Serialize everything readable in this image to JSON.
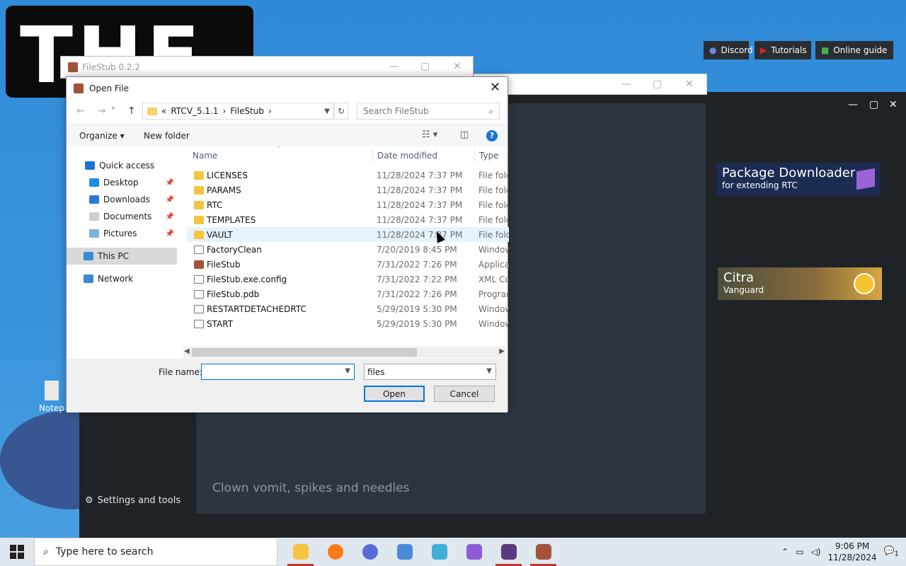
{
  "wallpaper": {
    "logo_text": "THE"
  },
  "background_window": {
    "title": "FileStub 0.2.2"
  },
  "rtc": {
    "buttons": [
      {
        "label": "Discord"
      },
      {
        "label": "Tutorials"
      },
      {
        "label": "Online guide"
      }
    ],
    "cards": [
      {
        "title": "Package Downloader",
        "subtitle": "for extending RTC"
      },
      {
        "title": "Citra",
        "subtitle": "Vanguard"
      }
    ],
    "quote": "Clown vomit, spikes and needles",
    "settings": "Settings and tools"
  },
  "dialog": {
    "title": "Open File",
    "breadcrumb": {
      "prefix": "«",
      "parts": [
        "RTCV_5.1.1",
        "FileStub"
      ]
    },
    "search_placeholder": "Search FileStub",
    "toolbar": {
      "organize": "Organize ▾",
      "new_folder": "New folder"
    },
    "nav": [
      {
        "label": "Quick access",
        "icon": "star-icon",
        "color": "#1b73d3"
      },
      {
        "label": "Desktop",
        "icon": "desktop-icon",
        "color": "#1b8fe0",
        "pinned": true
      },
      {
        "label": "Downloads",
        "icon": "download-icon",
        "color": "#2a7bd6",
        "pinned": true
      },
      {
        "label": "Documents",
        "icon": "documents-icon",
        "color": "#cfcfcf",
        "pinned": true
      },
      {
        "label": "Pictures",
        "icon": "pictures-icon",
        "color": "#7bb3e0",
        "pinned": true
      },
      {
        "label": "This PC",
        "icon": "computer-icon",
        "color": "#3a8ad6",
        "selected": true
      },
      {
        "label": "Network",
        "icon": "network-icon",
        "color": "#3a8ad6"
      }
    ],
    "columns": {
      "name": "Name",
      "date": "Date modified",
      "type": "Type"
    },
    "files": [
      {
        "name": "LICENSES",
        "date": "11/28/2024 7:37 PM",
        "type": "File folder",
        "kind": "folder"
      },
      {
        "name": "PARAMS",
        "date": "11/28/2024 7:37 PM",
        "type": "File folder",
        "kind": "folder"
      },
      {
        "name": "RTC",
        "date": "11/28/2024 7:37 PM",
        "type": "File folder",
        "kind": "folder"
      },
      {
        "name": "TEMPLATES",
        "date": "11/28/2024 7:37 PM",
        "type": "File folder",
        "kind": "folder"
      },
      {
        "name": "VAULT",
        "date": "11/28/2024 7:37 PM",
        "type": "File folder",
        "kind": "folder",
        "hover": true
      },
      {
        "name": "FactoryClean",
        "date": "7/20/2019 8:45 PM",
        "type": "Windows",
        "kind": "file"
      },
      {
        "name": "FileStub",
        "date": "7/31/2022 7:26 PM",
        "type": "Application",
        "kind": "exe"
      },
      {
        "name": "FileStub.exe.config",
        "date": "7/31/2022 7:22 PM",
        "type": "XML Config",
        "kind": "file"
      },
      {
        "name": "FileStub.pdb",
        "date": "7/31/2022 7:26 PM",
        "type": "Program",
        "kind": "file"
      },
      {
        "name": "RESTARTDETACHEDRTC",
        "date": "5/29/2019 5:30 PM",
        "type": "Windows",
        "kind": "file"
      },
      {
        "name": "START",
        "date": "5/29/2019 5:30 PM",
        "type": "Windows",
        "kind": "file"
      }
    ],
    "file_name_label": "File name:",
    "file_name_value": "",
    "file_type": "files",
    "open": "Open",
    "cancel": "Cancel"
  },
  "desktop_icon": "Notep",
  "taskbar": {
    "search_placeholder": "Type here to search",
    "apps": [
      {
        "name": "explorer",
        "color": "#f5c542",
        "active": true
      },
      {
        "name": "firefox",
        "color": "#ff7a18"
      },
      {
        "name": "app3",
        "color": "#5a6ad8"
      },
      {
        "name": "app4",
        "color": "#4a8ad8"
      },
      {
        "name": "app5",
        "color": "#3fb1d8"
      },
      {
        "name": "app6",
        "color": "#8b5cd6"
      },
      {
        "name": "rtc",
        "color": "#5a3a80",
        "active": true
      },
      {
        "name": "filestub",
        "color": "#a4533a",
        "active": true
      }
    ],
    "time": "9:06 PM",
    "date": "11/28/2024",
    "notifications": "1"
  }
}
